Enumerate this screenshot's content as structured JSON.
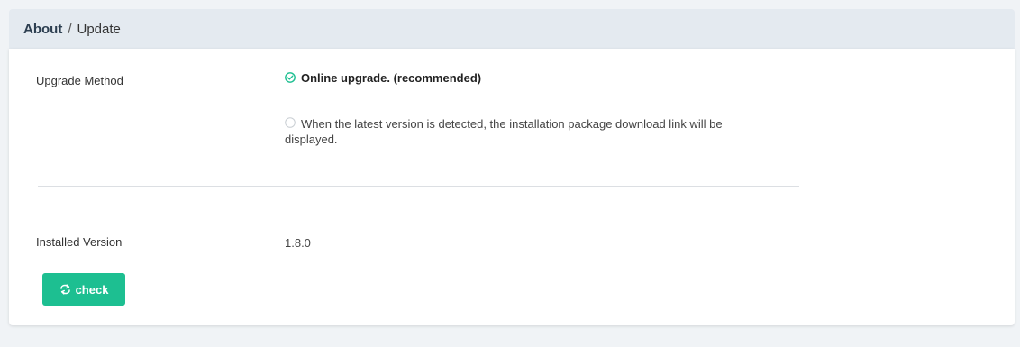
{
  "breadcrumb": {
    "root": "About",
    "separator": "/",
    "current": "Update"
  },
  "upgrade": {
    "label": "Upgrade Method",
    "options": [
      {
        "text": "Online upgrade. (recommended)",
        "selected": true,
        "icon": "check-circle-icon"
      },
      {
        "text_line1": "When the latest version is detected, the installation package download link will be",
        "text_line2": "displayed.",
        "selected": false,
        "icon": "radio-empty-icon"
      }
    ]
  },
  "installed": {
    "label": "Installed Version",
    "value": "1.8.0"
  },
  "check_button": {
    "label": "check",
    "icon": "refresh-arrows-icon"
  },
  "colors": {
    "accent": "#1dbf91",
    "header_bg": "#e4eaf0",
    "page_bg": "#f0f3f6"
  }
}
